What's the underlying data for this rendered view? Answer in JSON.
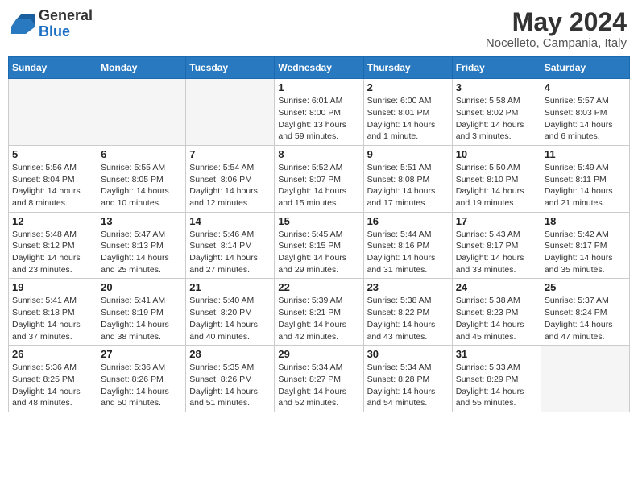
{
  "header": {
    "logo_general": "General",
    "logo_blue": "Blue",
    "month_year": "May 2024",
    "location": "Nocelleto, Campania, Italy"
  },
  "weekdays": [
    "Sunday",
    "Monday",
    "Tuesday",
    "Wednesday",
    "Thursday",
    "Friday",
    "Saturday"
  ],
  "weeks": [
    [
      {
        "day": null
      },
      {
        "day": null
      },
      {
        "day": null
      },
      {
        "day": "1",
        "sunrise": "Sunrise: 6:01 AM",
        "sunset": "Sunset: 8:00 PM",
        "daylight": "Daylight: 13 hours and 59 minutes."
      },
      {
        "day": "2",
        "sunrise": "Sunrise: 6:00 AM",
        "sunset": "Sunset: 8:01 PM",
        "daylight": "Daylight: 14 hours and 1 minute."
      },
      {
        "day": "3",
        "sunrise": "Sunrise: 5:58 AM",
        "sunset": "Sunset: 8:02 PM",
        "daylight": "Daylight: 14 hours and 3 minutes."
      },
      {
        "day": "4",
        "sunrise": "Sunrise: 5:57 AM",
        "sunset": "Sunset: 8:03 PM",
        "daylight": "Daylight: 14 hours and 6 minutes."
      }
    ],
    [
      {
        "day": "5",
        "sunrise": "Sunrise: 5:56 AM",
        "sunset": "Sunset: 8:04 PM",
        "daylight": "Daylight: 14 hours and 8 minutes."
      },
      {
        "day": "6",
        "sunrise": "Sunrise: 5:55 AM",
        "sunset": "Sunset: 8:05 PM",
        "daylight": "Daylight: 14 hours and 10 minutes."
      },
      {
        "day": "7",
        "sunrise": "Sunrise: 5:54 AM",
        "sunset": "Sunset: 8:06 PM",
        "daylight": "Daylight: 14 hours and 12 minutes."
      },
      {
        "day": "8",
        "sunrise": "Sunrise: 5:52 AM",
        "sunset": "Sunset: 8:07 PM",
        "daylight": "Daylight: 14 hours and 15 minutes."
      },
      {
        "day": "9",
        "sunrise": "Sunrise: 5:51 AM",
        "sunset": "Sunset: 8:08 PM",
        "daylight": "Daylight: 14 hours and 17 minutes."
      },
      {
        "day": "10",
        "sunrise": "Sunrise: 5:50 AM",
        "sunset": "Sunset: 8:10 PM",
        "daylight": "Daylight: 14 hours and 19 minutes."
      },
      {
        "day": "11",
        "sunrise": "Sunrise: 5:49 AM",
        "sunset": "Sunset: 8:11 PM",
        "daylight": "Daylight: 14 hours and 21 minutes."
      }
    ],
    [
      {
        "day": "12",
        "sunrise": "Sunrise: 5:48 AM",
        "sunset": "Sunset: 8:12 PM",
        "daylight": "Daylight: 14 hours and 23 minutes."
      },
      {
        "day": "13",
        "sunrise": "Sunrise: 5:47 AM",
        "sunset": "Sunset: 8:13 PM",
        "daylight": "Daylight: 14 hours and 25 minutes."
      },
      {
        "day": "14",
        "sunrise": "Sunrise: 5:46 AM",
        "sunset": "Sunset: 8:14 PM",
        "daylight": "Daylight: 14 hours and 27 minutes."
      },
      {
        "day": "15",
        "sunrise": "Sunrise: 5:45 AM",
        "sunset": "Sunset: 8:15 PM",
        "daylight": "Daylight: 14 hours and 29 minutes."
      },
      {
        "day": "16",
        "sunrise": "Sunrise: 5:44 AM",
        "sunset": "Sunset: 8:16 PM",
        "daylight": "Daylight: 14 hours and 31 minutes."
      },
      {
        "day": "17",
        "sunrise": "Sunrise: 5:43 AM",
        "sunset": "Sunset: 8:17 PM",
        "daylight": "Daylight: 14 hours and 33 minutes."
      },
      {
        "day": "18",
        "sunrise": "Sunrise: 5:42 AM",
        "sunset": "Sunset: 8:17 PM",
        "daylight": "Daylight: 14 hours and 35 minutes."
      }
    ],
    [
      {
        "day": "19",
        "sunrise": "Sunrise: 5:41 AM",
        "sunset": "Sunset: 8:18 PM",
        "daylight": "Daylight: 14 hours and 37 minutes."
      },
      {
        "day": "20",
        "sunrise": "Sunrise: 5:41 AM",
        "sunset": "Sunset: 8:19 PM",
        "daylight": "Daylight: 14 hours and 38 minutes."
      },
      {
        "day": "21",
        "sunrise": "Sunrise: 5:40 AM",
        "sunset": "Sunset: 8:20 PM",
        "daylight": "Daylight: 14 hours and 40 minutes."
      },
      {
        "day": "22",
        "sunrise": "Sunrise: 5:39 AM",
        "sunset": "Sunset: 8:21 PM",
        "daylight": "Daylight: 14 hours and 42 minutes."
      },
      {
        "day": "23",
        "sunrise": "Sunrise: 5:38 AM",
        "sunset": "Sunset: 8:22 PM",
        "daylight": "Daylight: 14 hours and 43 minutes."
      },
      {
        "day": "24",
        "sunrise": "Sunrise: 5:38 AM",
        "sunset": "Sunset: 8:23 PM",
        "daylight": "Daylight: 14 hours and 45 minutes."
      },
      {
        "day": "25",
        "sunrise": "Sunrise: 5:37 AM",
        "sunset": "Sunset: 8:24 PM",
        "daylight": "Daylight: 14 hours and 47 minutes."
      }
    ],
    [
      {
        "day": "26",
        "sunrise": "Sunrise: 5:36 AM",
        "sunset": "Sunset: 8:25 PM",
        "daylight": "Daylight: 14 hours and 48 minutes."
      },
      {
        "day": "27",
        "sunrise": "Sunrise: 5:36 AM",
        "sunset": "Sunset: 8:26 PM",
        "daylight": "Daylight: 14 hours and 50 minutes."
      },
      {
        "day": "28",
        "sunrise": "Sunrise: 5:35 AM",
        "sunset": "Sunset: 8:26 PM",
        "daylight": "Daylight: 14 hours and 51 minutes."
      },
      {
        "day": "29",
        "sunrise": "Sunrise: 5:34 AM",
        "sunset": "Sunset: 8:27 PM",
        "daylight": "Daylight: 14 hours and 52 minutes."
      },
      {
        "day": "30",
        "sunrise": "Sunrise: 5:34 AM",
        "sunset": "Sunset: 8:28 PM",
        "daylight": "Daylight: 14 hours and 54 minutes."
      },
      {
        "day": "31",
        "sunrise": "Sunrise: 5:33 AM",
        "sunset": "Sunset: 8:29 PM",
        "daylight": "Daylight: 14 hours and 55 minutes."
      },
      {
        "day": null
      }
    ]
  ]
}
